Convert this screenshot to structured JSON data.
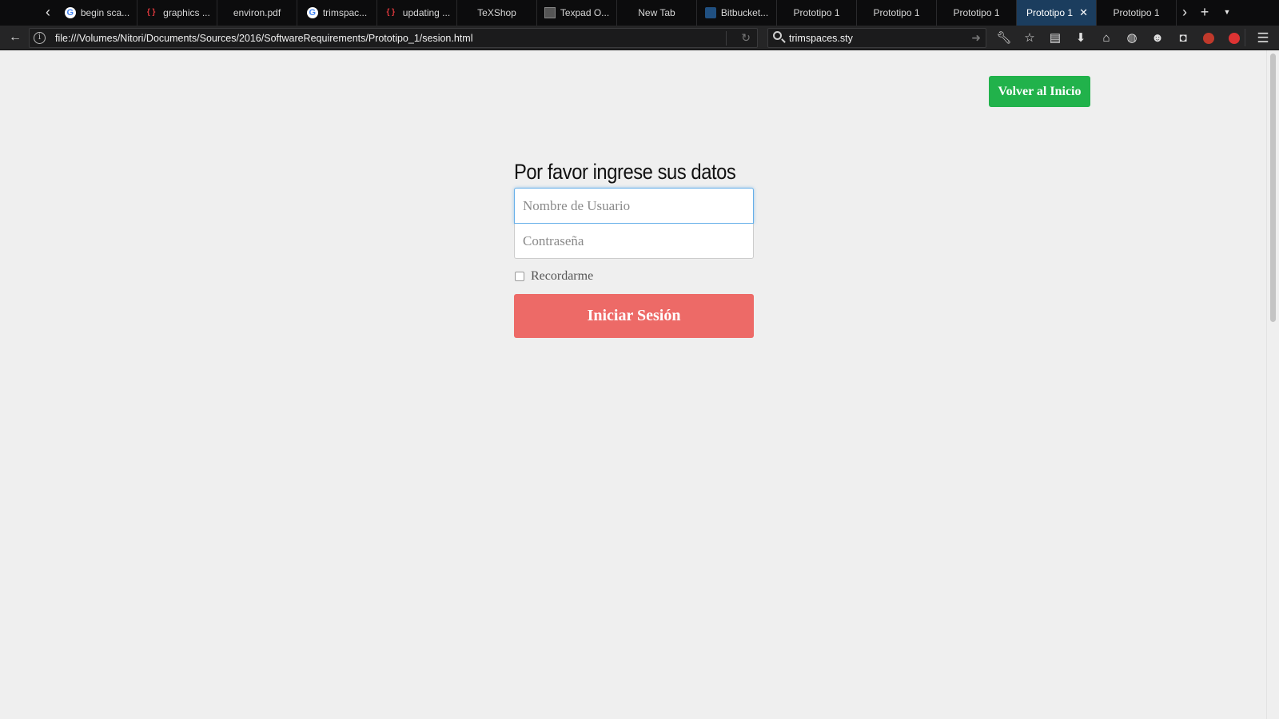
{
  "browser": {
    "tabs": [
      {
        "label": "begin sca...",
        "icon": "google-icon",
        "active": false
      },
      {
        "label": "graphics ...",
        "icon": "braces-icon",
        "active": false
      },
      {
        "label": "environ.pdf",
        "icon": "",
        "active": false
      },
      {
        "label": "trimspac...",
        "icon": "google-icon",
        "active": false
      },
      {
        "label": "updating ...",
        "icon": "braces-icon",
        "active": false
      },
      {
        "label": "TeXShop",
        "icon": "",
        "active": false
      },
      {
        "label": "Texpad O...",
        "icon": "doc-icon",
        "active": false
      },
      {
        "label": "New Tab",
        "icon": "",
        "active": false
      },
      {
        "label": "Bitbucket...",
        "icon": "bitbucket-icon",
        "active": false
      },
      {
        "label": "Prototipo 1",
        "icon": "",
        "active": false
      },
      {
        "label": "Prototipo 1",
        "icon": "",
        "active": false
      },
      {
        "label": "Prototipo 1",
        "icon": "",
        "active": false
      },
      {
        "label": "Prototipo 1",
        "icon": "",
        "active": true
      },
      {
        "label": "Prototipo 1",
        "icon": "",
        "active": false
      }
    ],
    "url": "file:///Volumes/Nitori/Documents/Sources/2016/SoftwareRequirements/Prototipo_1/sesion.html",
    "search_value": "trimspaces.sty",
    "toolbar_icons": [
      "wrench-icon",
      "bookmark-star-icon",
      "reading-list-icon",
      "download-icon",
      "home-icon",
      "network-icon",
      "chat-icon",
      "pocket-icon",
      "ublock-icon",
      "extension-icon"
    ]
  },
  "page": {
    "home_button": "Volver al Inicio",
    "form_title": "Por favor ingrese sus datos",
    "username_placeholder": "Nombre de Usuario",
    "password_placeholder": "Contraseña",
    "remember_label": "Recordarme",
    "remember_checked": false,
    "login_button": "Iniciar Sesión"
  },
  "colors": {
    "home_button": "#21b24b",
    "login_button": "#ed6a67",
    "active_tab": "#1b3d5e",
    "focus_border": "#66afe9"
  }
}
